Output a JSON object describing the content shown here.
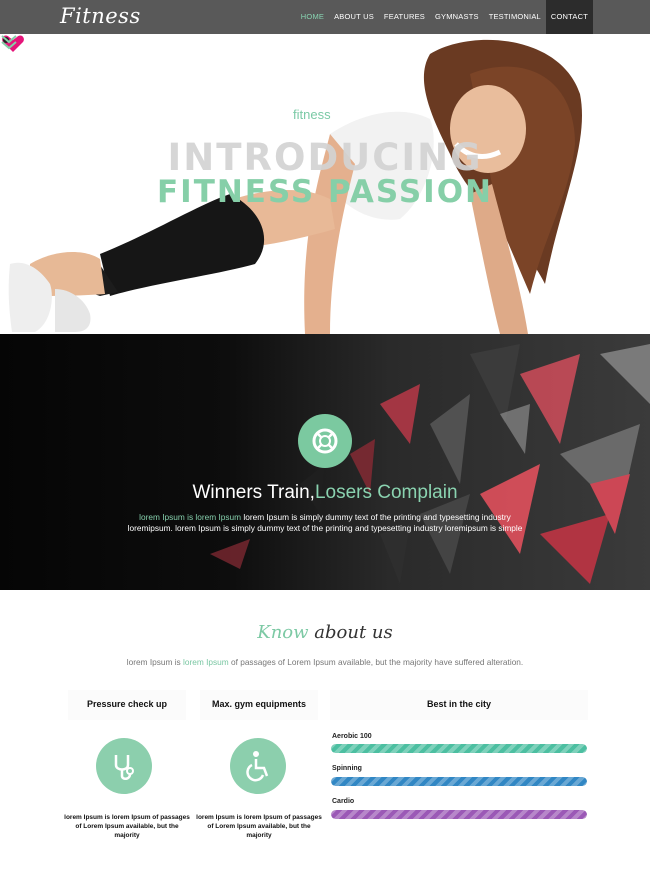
{
  "nav": {
    "logo": "Fitness",
    "items": [
      {
        "label": "HOME",
        "active": true
      },
      {
        "label": "ABOUT US",
        "active": false
      },
      {
        "label": "FEATURES",
        "active": false
      },
      {
        "label": "GYMNASTS",
        "active": false
      },
      {
        "label": "TESTIMONIAL",
        "active": false
      },
      {
        "label": "CONTACT",
        "active": false
      }
    ]
  },
  "hero": {
    "brand": "fitness",
    "line1": "INTRODUCING",
    "line2": "FITNESS PASSION",
    "scroll_icon": "double-chevron-down-icon"
  },
  "band": {
    "icon": "lifebuoy-icon",
    "title_main": "Winners Train,",
    "title_accent": "Losers Complain",
    "text_highlight": "lorem Ipsum is lorem Ipsum",
    "text_rest_1": " lorem Ipsum is simply dummy text of the printing and typesetting industry",
    "text_line2": "loremipsum. lorem Ipsum is simply dummy text of the printing and typesetting industry loremipsum is simple"
  },
  "about": {
    "title_accent": "Know",
    "title_rest": "about us",
    "subtitle_pre": "lorem Ipsum is ",
    "subtitle_highlight": "lorem Ipsum",
    "subtitle_post": " of passages of Lorem Ipsum available, but the majority have suffered alteration.",
    "features": [
      {
        "title": "Pressure check up",
        "icon": "stethoscope-icon",
        "text": "lorem Ipsum is lorem Ipsum of passages of Lorem Ipsum available, but the majority"
      },
      {
        "title": "Max. gym equipments",
        "icon": "wheelchair-icon",
        "text": "lorem Ipsum is lorem Ipsum of passages of Lorem Ipsum available, but the majority"
      }
    ],
    "best": {
      "title": "Best in the city",
      "bars": [
        {
          "label": "Aerobic 100",
          "value": 1.0,
          "color": "#4cbfa1"
        },
        {
          "label": "Spinning",
          "value": 1.0,
          "color": "#3187c4"
        },
        {
          "label": "Cardio",
          "value": 1.0,
          "color": "#9b59b6"
        }
      ]
    }
  },
  "colors": {
    "accent": "#7cc9a4",
    "nav_bg": "#595959",
    "contact_bg": "#2c2c2c"
  }
}
